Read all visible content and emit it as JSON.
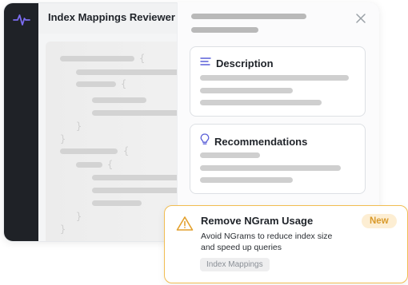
{
  "app": {
    "title": "Index Mappings Reviewer"
  },
  "details": {
    "description_title": "Description",
    "recommendations_title": "Recommendations"
  },
  "notification": {
    "title": "Remove NGram Usage",
    "description": "Avoid NGrams to reduce index size and speed up queries",
    "badge": "New",
    "tag": "Index Mappings"
  },
  "icons": {
    "logo": "activity-pulse-icon",
    "close": "close-icon",
    "description": "align-left-icon",
    "recommendations": "lightbulb-icon",
    "warning": "warning-triangle-icon"
  },
  "colors": {
    "rail": "#1f2227",
    "logo_accent": "#7b6cf0",
    "notification_border": "#f1bd52",
    "warning": "#e3a12e",
    "badge_bg": "#fdeed3",
    "badge_text": "#d99a2b"
  }
}
